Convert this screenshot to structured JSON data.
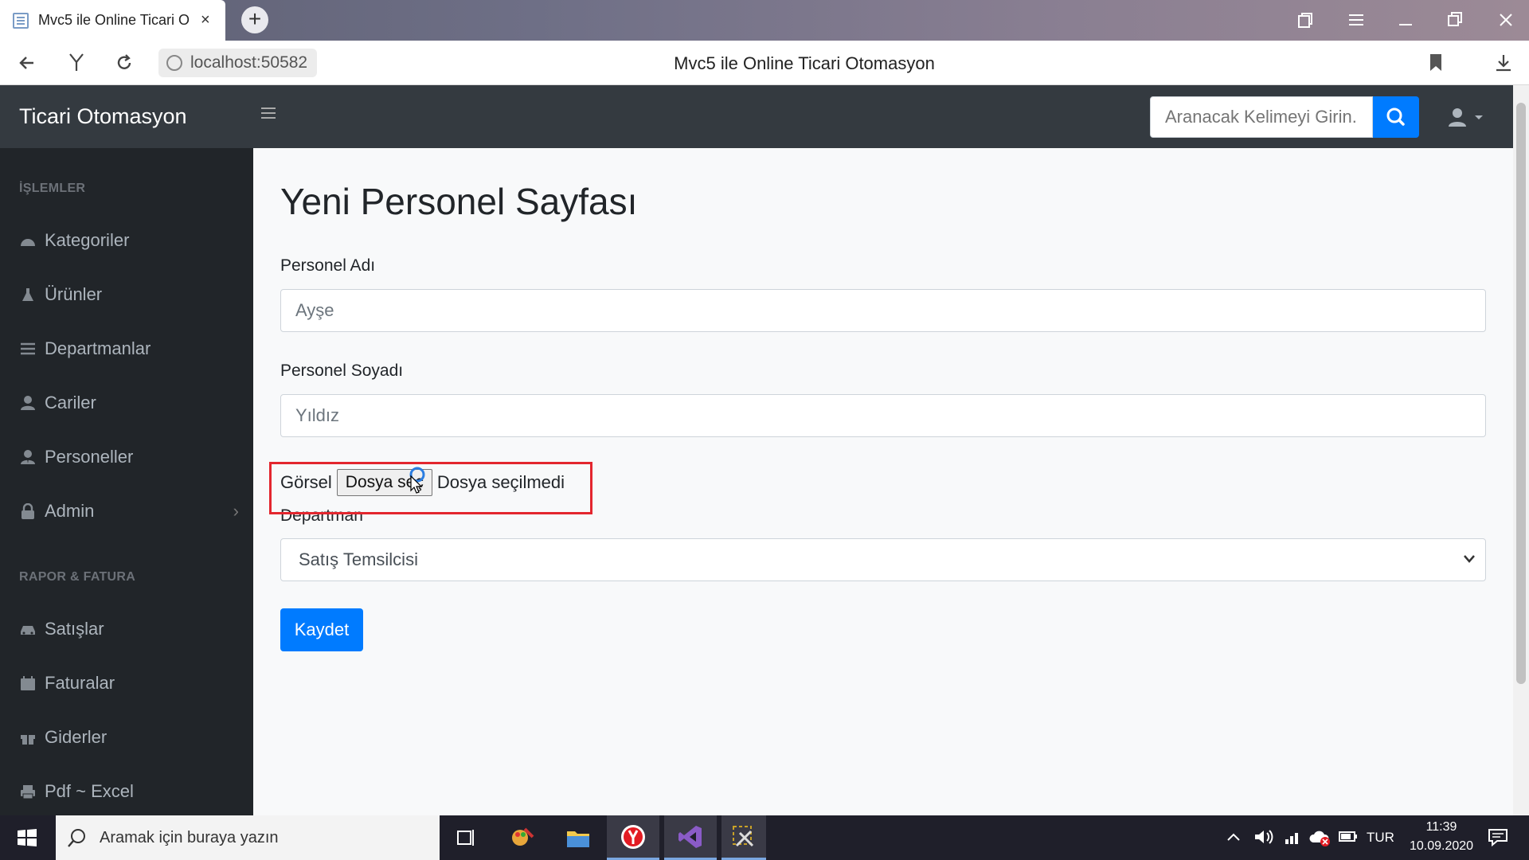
{
  "browser": {
    "tab_title": "Mvc5 ile Online Ticari O",
    "tab_close": "×",
    "new_tab": "+",
    "url": "localhost:50582",
    "page_title": "Mvc5 ile Online Ticari Otomasyon"
  },
  "navbar": {
    "brand": "Ticari Otomasyon",
    "search_placeholder": "Aranacak Kelimeyi Girin..."
  },
  "sidebar": {
    "section1": "İŞLEMLER",
    "items1": [
      {
        "label": "Kategoriler",
        "icon": "dashboard-icon"
      },
      {
        "label": "Ürünler",
        "icon": "flask-icon"
      },
      {
        "label": "Departmanlar",
        "icon": "list-icon"
      },
      {
        "label": "Cariler",
        "icon": "user-icon"
      },
      {
        "label": "Personeller",
        "icon": "user-tie-icon"
      },
      {
        "label": "Admin",
        "icon": "lock-icon"
      }
    ],
    "admin_chevron": "›",
    "section2": "RAPOR & FATURA",
    "items2": [
      {
        "label": "Satışlar",
        "icon": "car-icon"
      },
      {
        "label": "Faturalar",
        "icon": "calendar-icon"
      },
      {
        "label": "Giderler",
        "icon": "gift-icon"
      },
      {
        "label": "Pdf ~ Excel",
        "icon": "print-icon"
      }
    ]
  },
  "main": {
    "heading": "Yeni Personel Sayfası",
    "first_name_label": "Personel Adı",
    "first_name_value": "Ayşe",
    "last_name_label": "Personel Soyadı",
    "last_name_value": "Yıldız",
    "image_label": "Görsel",
    "file_button": "Dosya seç",
    "file_status": "Dosya seçilmedi",
    "department_label": "Departman",
    "department_selected": "Satış Temsilcisi",
    "save_button": "Kaydet"
  },
  "taskbar": {
    "search_placeholder": "Aramak için buraya yazın",
    "language": "TUR",
    "time": "11:39",
    "date": "10.09.2020"
  },
  "colors": {
    "primary": "#007bff",
    "navbar": "#343a40",
    "sidebar": "#212529",
    "highlight": "#e3262e"
  }
}
